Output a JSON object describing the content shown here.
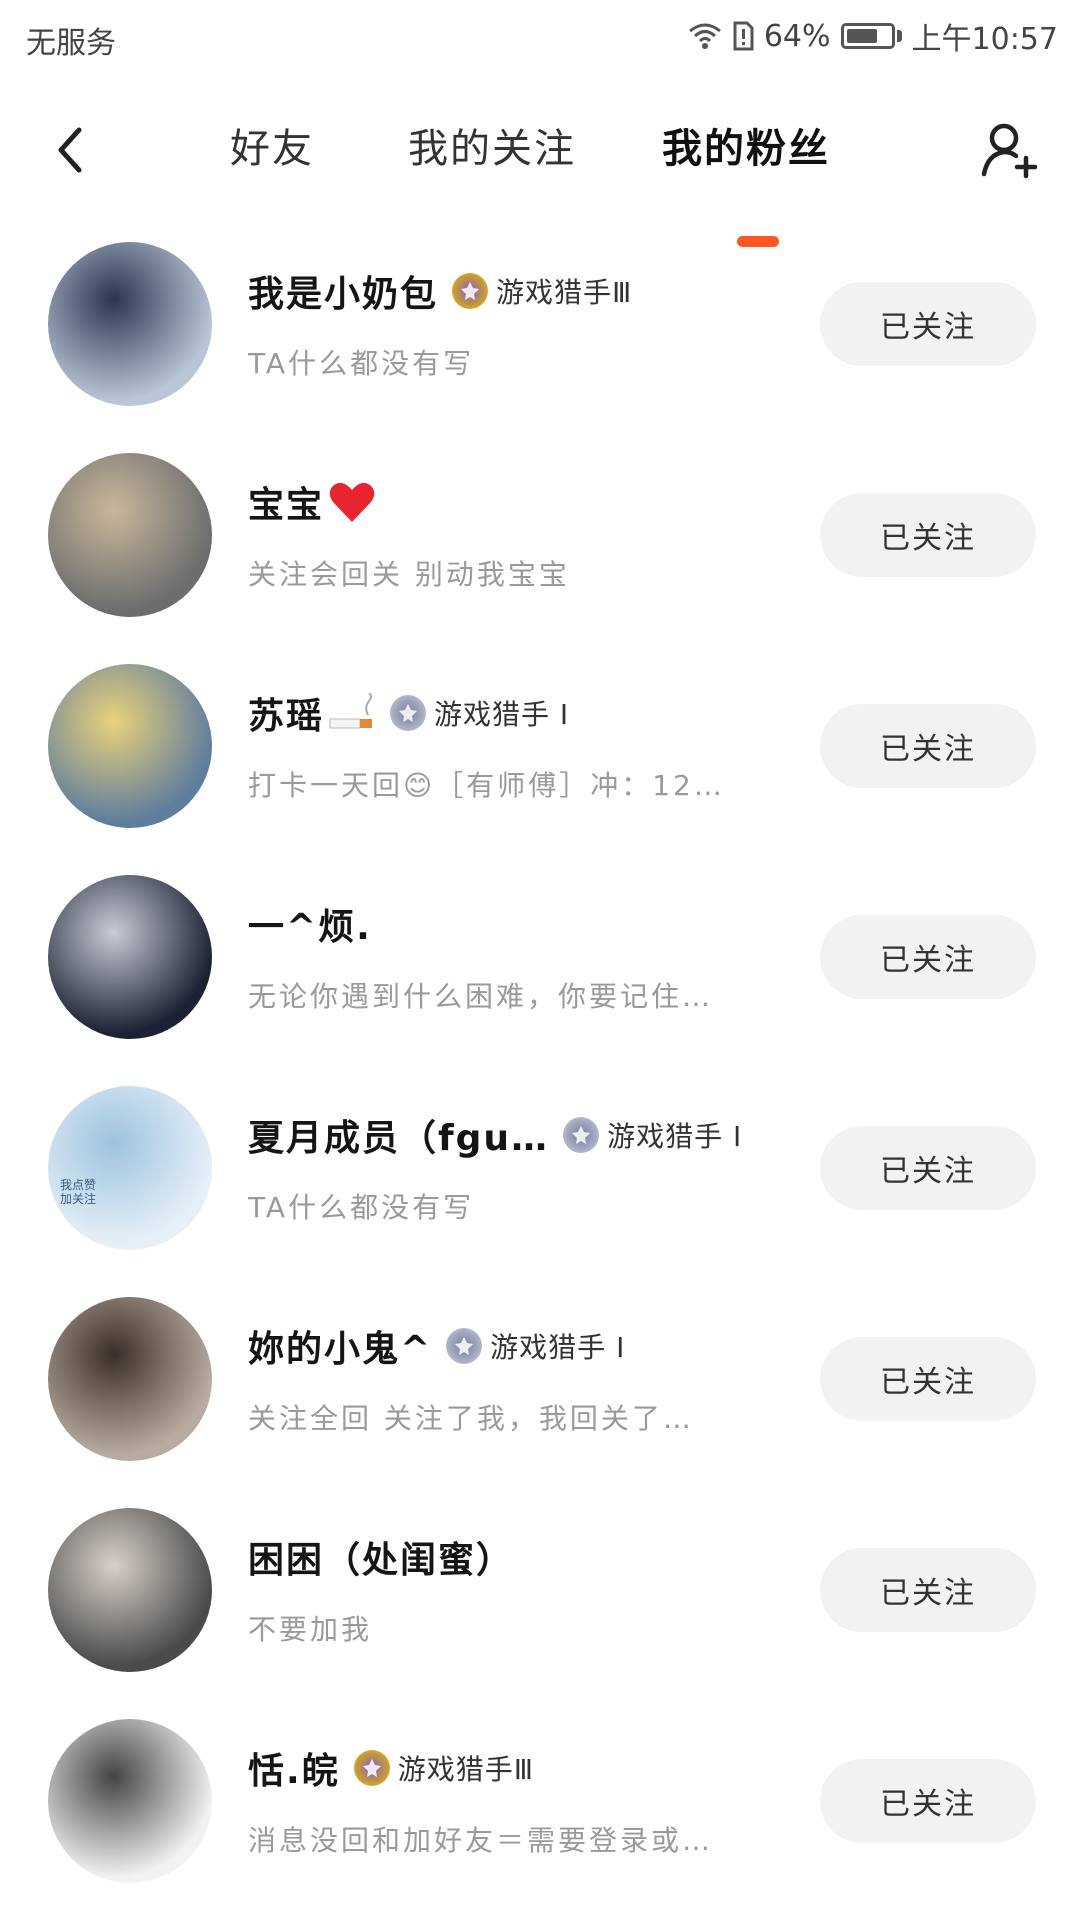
{
  "status_bar": {
    "carrier": "无服务",
    "battery": "64%",
    "time": "上午10:57"
  },
  "header": {
    "tabs": [
      {
        "label": "好友",
        "active": false
      },
      {
        "label": "我的关注",
        "active": false
      },
      {
        "label": "我的粉丝",
        "active": true
      }
    ]
  },
  "fans": [
    {
      "name": "我是小奶包",
      "badge": "游戏猎手Ⅲ",
      "badge_tier": "gold",
      "desc": "TA什么都没有写",
      "button": "已关注",
      "avatar_colors": [
        "#b8c6d6",
        "#2b3550"
      ]
    },
    {
      "name": "宝宝",
      "emoji": "heart",
      "desc": "关注会回关 别动我宝宝",
      "button": "已关注",
      "avatar_colors": [
        "#6d6d6d",
        "#c9b79c"
      ]
    },
    {
      "name": "苏瑶",
      "emoji": "cigarette",
      "badge": "游戏猎手 Ⅰ",
      "badge_tier": "silver",
      "desc": "打卡一天回😊［有师傅］冲：12…",
      "button": "已关注",
      "avatar_colors": [
        "#5f7d9e",
        "#e9d27a"
      ]
    },
    {
      "name": "一^烦.",
      "desc": "无论你遇到什么困难，你要记住…",
      "button": "已关注",
      "avatar_colors": [
        "#1c2233",
        "#c9ccd6"
      ]
    },
    {
      "name": "夏月成员（fgu…",
      "badge": "游戏猎手 Ⅰ",
      "badge_tier": "silver",
      "desc": "TA什么都没有写",
      "button": "已关注",
      "avatar_colors": [
        "#e6f0f8",
        "#9ec3de"
      ],
      "avatar_text": "我点赞 加关注"
    },
    {
      "name": "妳的小鬼^",
      "badge": "游戏猎手 Ⅰ",
      "badge_tier": "silver",
      "desc": "关注全回 关注了我，我回关了…",
      "button": "已关注",
      "avatar_colors": [
        "#b8aca0",
        "#3a2e28"
      ]
    },
    {
      "name": "困困（处闺蜜）",
      "desc": "不要加我",
      "button": "已关注",
      "avatar_colors": [
        "#4a4a4a",
        "#d8d0c8"
      ]
    },
    {
      "name": "恬.皖",
      "badge": "游戏猎手Ⅲ",
      "badge_tier": "gold",
      "desc": "消息没回和加好友＝需要登录或…",
      "button": "已关注",
      "avatar_colors": [
        "#f2f2f2",
        "#444444"
      ]
    }
  ]
}
